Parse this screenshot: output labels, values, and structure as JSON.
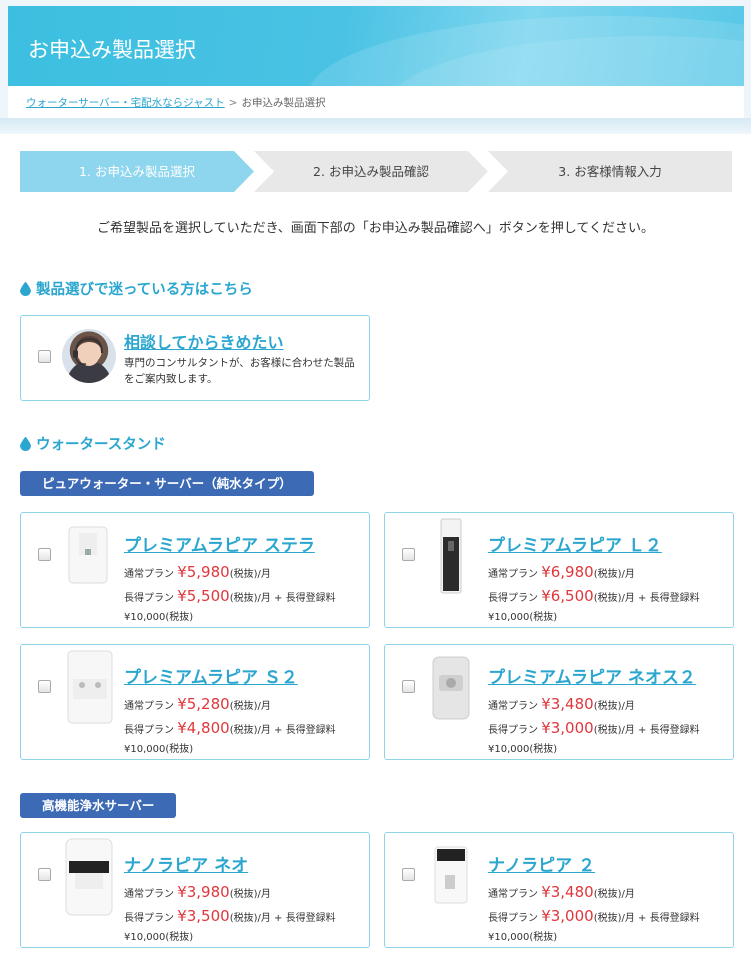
{
  "header": {
    "title": "お申込み製品選択"
  },
  "breadcrumb": {
    "home": "ウォーターサーバー・宅配水ならジャスト",
    "separator": ">",
    "current": "お申込み製品選択"
  },
  "steps": [
    "1. お申込み製品選択",
    "2. お申込み製品確認",
    "3. お客様情報入力"
  ],
  "intro": "ご希望製品を選択していただき、画面下部の「お申込み製品確認へ」ボタンを押してください。",
  "consult_section": {
    "title": "製品選びで迷っている方はこちら",
    "name": "相談してからきめたい",
    "desc": "専門のコンサルタントが、お客様に合わせた製品をご案内致します。"
  },
  "stand_section": {
    "title": "ウォータースタンド"
  },
  "category_pure": "ピュアウォーター・サーバー（純水タイプ）",
  "category_filter": "高機能浄水サーバー",
  "plan_labels": {
    "normal": "通常プラン",
    "long": "長得プラン",
    "per_month": "(税抜)/月",
    "long_suffix": "(税抜)/月 + 長得登録料",
    "fee": "¥10,000(税抜)"
  },
  "products": [
    {
      "name": "プレミアムラピア ステラ",
      "normal_price": "¥5,980",
      "long_price": "¥5,500"
    },
    {
      "name": "プレミアムラピア Ｌ２",
      "normal_price": "¥6,980",
      "long_price": "¥6,500"
    },
    {
      "name": "プレミアムラピア Ｓ２",
      "normal_price": "¥5,280",
      "long_price": "¥4,800"
    },
    {
      "name": "プレミアムラピア ネオス２",
      "normal_price": "¥3,480",
      "long_price": "¥3,000"
    },
    {
      "name": "ナノラピア ネオ",
      "normal_price": "¥3,980",
      "long_price": "¥3,500"
    },
    {
      "name": "ナノラピア ２",
      "normal_price": "¥3,480",
      "long_price": "¥3,000"
    }
  ],
  "colors": {
    "accent": "#2aa6cf",
    "price": "#e0373c",
    "tag": "#3d6ab4",
    "header": "#3bbfe0"
  }
}
